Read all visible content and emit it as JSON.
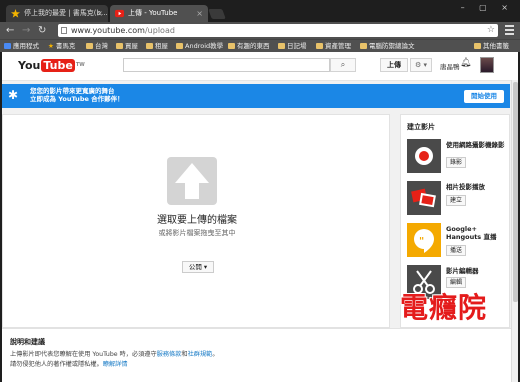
{
  "browser": {
    "tabs": [
      {
        "title": "停上我的最愛 | 書馬克(b..."
      },
      {
        "title": "上傳 - YouTube"
      }
    ],
    "address": {
      "host": "www.youtube.com",
      "path": "/upload"
    },
    "bookmarks": [
      "應用程式",
      "書馬克",
      "台灣",
      "買屋",
      "租屋",
      "Android教學",
      "有趣的東西",
      "日記場",
      "資產管理",
      "電腦防禦總論文",
      "其他書籤"
    ]
  },
  "youtube": {
    "logo_you": "You",
    "logo_tube": "Tube",
    "logo_tw": "TW",
    "upload_label": "上傳",
    "settings_glyph": "⚙ ▾",
    "username": "唐晶鴨"
  },
  "banner": {
    "line1": "您您的影片帶來更寬廣的舞台",
    "line2": "立即成為 YouTube 合作夥伴！",
    "button": "開始使用"
  },
  "upload": {
    "title": "選取要上傳的檔案",
    "hint": "或將影片檔案拖曳至其中",
    "privacy": "公開 ▾"
  },
  "create": {
    "title": "建立影片",
    "items": [
      {
        "label": "使用網路攝影機錄影",
        "button": "錄影"
      },
      {
        "label": "相片投影播放",
        "button": "建立"
      },
      {
        "label": "Google+ Hangouts 直播",
        "button": "播送"
      },
      {
        "label": "影片編輯器",
        "button": "編輯"
      }
    ]
  },
  "help": {
    "title": "說明和建議",
    "line1_pre": "上傳影片即代表您瞭解在使用 YouTube 時，必須遵守",
    "line1_link1": "服務條款",
    "line1_mid": "和",
    "line1_link2": "社群規範",
    "line1_post": "。",
    "line2_pre": "請勿侵犯他人的著作權或隱私權。",
    "line2_link": "瞭解詳情"
  },
  "watermark": "電癮院"
}
